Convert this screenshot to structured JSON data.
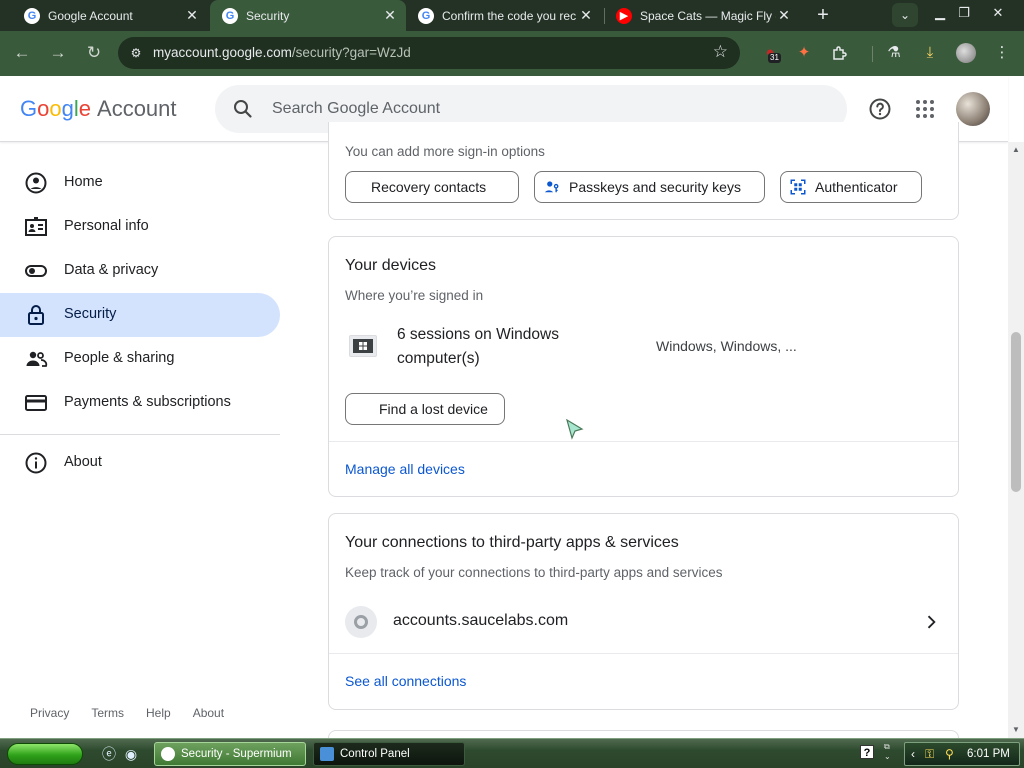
{
  "browser": {
    "tabs": [
      {
        "title": "Google Account",
        "favicon": "google-g-icon"
      },
      {
        "title": "Security",
        "favicon": "google-g-icon"
      },
      {
        "title": "Confirm the code you rec",
        "favicon": "google-g-icon"
      },
      {
        "title": "Space Cats — Magic Fly -",
        "favicon": "youtube-icon"
      }
    ],
    "new_tab_label": "+",
    "url_host": "myaccount.google.com",
    "url_path": "/security?gar=WzJd",
    "extension_badge": "31"
  },
  "header": {
    "logo_word": "Google",
    "logo_suffix": "Account",
    "search_placeholder": "Search Google Account"
  },
  "sidebar": {
    "items": [
      {
        "label": "Home",
        "icon": "home-icon"
      },
      {
        "label": "Personal info",
        "icon": "personal-info-icon"
      },
      {
        "label": "Data & privacy",
        "icon": "toggle-icon"
      },
      {
        "label": "Security",
        "icon": "lock-icon"
      },
      {
        "label": "People & sharing",
        "icon": "people-icon"
      },
      {
        "label": "Payments & subscriptions",
        "icon": "card-icon"
      },
      {
        "label": "About",
        "icon": "info-icon"
      }
    ],
    "footer": [
      "Privacy",
      "Terms",
      "Help",
      "About"
    ]
  },
  "signin_card": {
    "text": "You can add more sign-in options",
    "chips": [
      "Recovery contacts",
      "Passkeys and security keys",
      "Authenticator"
    ]
  },
  "devices_card": {
    "title": "Your devices",
    "subtitle": "Where you’re signed in",
    "sessions": "6 sessions on Windows computer(s)",
    "device_names": "Windows, Windows, ...",
    "find_button": "Find a lost device",
    "manage_link": "Manage all devices"
  },
  "connections_card": {
    "title": "Your connections to third-party apps & services",
    "subtitle": "Keep track of your connections to third-party apps and services",
    "connection": "accounts.saucelabs.com",
    "see_all_link": "See all connections"
  },
  "taskbar": {
    "tasks": [
      "Security - Supermium",
      "Control Panel"
    ],
    "clock": "6:01 PM"
  },
  "colors": {
    "accent": "#0b57d0",
    "selected_nav": "#d3e3fd",
    "browser_frame": "#3a5a3c",
    "tabstrip": "#233224"
  }
}
